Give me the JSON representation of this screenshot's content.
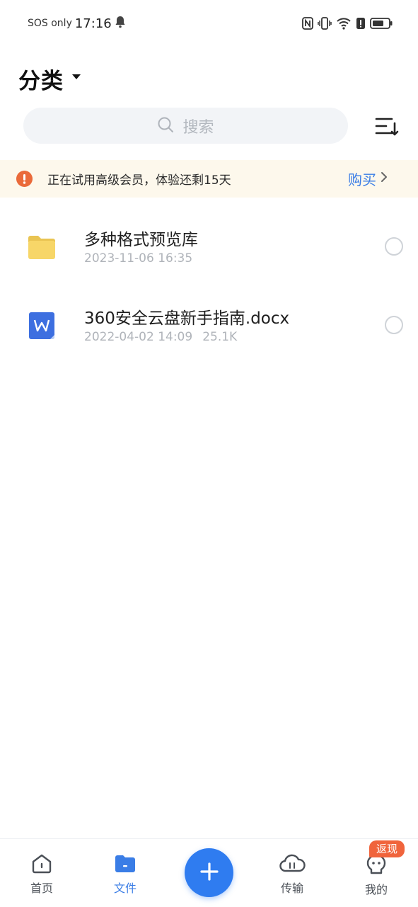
{
  "status_bar": {
    "carrier": "SOS only",
    "time": "17:16",
    "icons": [
      "bell-icon",
      "nfc-icon",
      "vibrate-icon",
      "wifi-icon",
      "alert-icon",
      "battery-icon"
    ]
  },
  "header": {
    "title": "分类",
    "search_placeholder": "搜索"
  },
  "banner": {
    "text": "正在试用高级会员，体验还剩15天",
    "action_label": "购买"
  },
  "files": [
    {
      "name": "多种格式预览库",
      "date": "2023-11-06 16:35",
      "size": "",
      "type": "folder"
    },
    {
      "name": "360安全云盘新手指南.docx",
      "date": "2022-04-02 14:09",
      "size": "25.1K",
      "type": "docx"
    }
  ],
  "bottom_nav": {
    "items": [
      {
        "label": "首页"
      },
      {
        "label": "文件"
      },
      {
        "label": "传输"
      },
      {
        "label": "我的"
      }
    ],
    "badge": "返现"
  },
  "colors": {
    "accent": "#2f7cf0",
    "warning": "#ea6a3a",
    "folder": "#f7d668",
    "word": "#3d6fe0"
  }
}
